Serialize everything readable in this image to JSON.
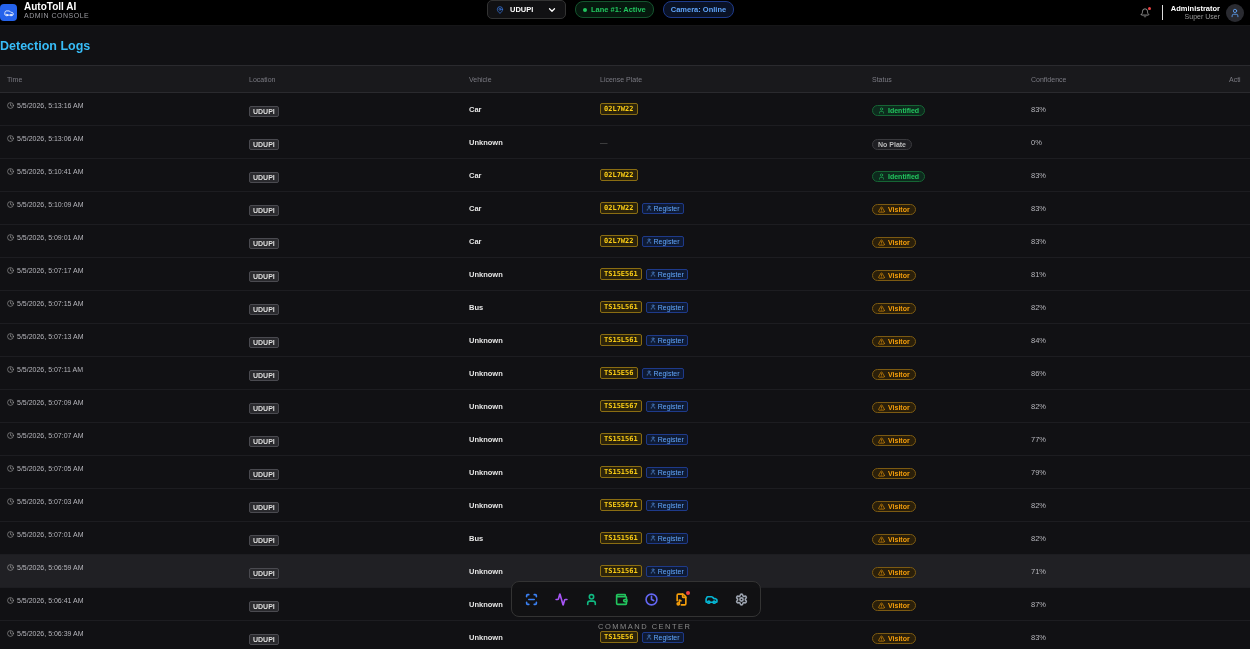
{
  "header": {
    "app_name": "AutoToll AI",
    "app_subtitle": "ADMIN CONSOLE",
    "location": "UDUPI",
    "lane_status": "Lane #1: Active",
    "camera_status": "Camera: Online",
    "notification_badge": true,
    "user_name": "Administrator",
    "user_role": "Super User"
  },
  "page_title": "Detection Logs",
  "table": {
    "columns": [
      "Time",
      "Location",
      "Vehicle",
      "License Plate",
      "Status",
      "Confidence",
      "Acti"
    ],
    "rows": [
      {
        "time": "5/5/2026, 5:13:16 AM",
        "location": "UDUPI",
        "vehicle": "Car",
        "plate": {
          "kind": "plate",
          "text": "02L7W22"
        },
        "status": {
          "kind": "identified",
          "text": "Identified"
        },
        "confidence": "83%",
        "selected": false
      },
      {
        "time": "5/5/2026, 5:13:06 AM",
        "location": "UDUPI",
        "vehicle": "Unknown",
        "plate": {
          "kind": "none",
          "text": "—"
        },
        "status": {
          "kind": "no_plate",
          "text": "No Plate"
        },
        "confidence": "0%",
        "selected": false
      },
      {
        "time": "5/5/2026, 5:10:41 AM",
        "location": "UDUPI",
        "vehicle": "Car",
        "plate": {
          "kind": "plate",
          "text": "02L7W22"
        },
        "status": {
          "kind": "identified",
          "text": "Identified"
        },
        "confidence": "83%",
        "selected": false
      },
      {
        "time": "5/5/2026, 5:10:09 AM",
        "location": "UDUPI",
        "vehicle": "Car",
        "plate": {
          "kind": "plate",
          "text": "02L7W22"
        },
        "register": "Register",
        "status": {
          "kind": "visitor",
          "text": "Visitor"
        },
        "confidence": "83%",
        "selected": false
      },
      {
        "time": "5/5/2026, 5:09:01 AM",
        "location": "UDUPI",
        "vehicle": "Car",
        "plate": {
          "kind": "plate",
          "text": "02L7W22"
        },
        "register": "Register",
        "status": {
          "kind": "visitor",
          "text": "Visitor"
        },
        "confidence": "83%",
        "selected": false
      },
      {
        "time": "5/5/2026, 5:07:17 AM",
        "location": "UDUPI",
        "vehicle": "Unknown",
        "plate": {
          "kind": "plate",
          "text": "TS15E561"
        },
        "register": "Register",
        "status": {
          "kind": "visitor",
          "text": "Visitor"
        },
        "confidence": "81%",
        "selected": false
      },
      {
        "time": "5/5/2026, 5:07:15 AM",
        "location": "UDUPI",
        "vehicle": "Bus",
        "plate": {
          "kind": "plate",
          "text": "TS15L561"
        },
        "register": "Register",
        "status": {
          "kind": "visitor",
          "text": "Visitor"
        },
        "confidence": "82%",
        "selected": false
      },
      {
        "time": "5/5/2026, 5:07:13 AM",
        "location": "UDUPI",
        "vehicle": "Unknown",
        "plate": {
          "kind": "plate",
          "text": "TS15L561"
        },
        "register": "Register",
        "status": {
          "kind": "visitor",
          "text": "Visitor"
        },
        "confidence": "84%",
        "selected": false
      },
      {
        "time": "5/5/2026, 5:07:11 AM",
        "location": "UDUPI",
        "vehicle": "Unknown",
        "plate": {
          "kind": "plate",
          "text": "TS15E56"
        },
        "register": "Register",
        "status": {
          "kind": "visitor",
          "text": "Visitor"
        },
        "confidence": "86%",
        "selected": false
      },
      {
        "time": "5/5/2026, 5:07:09 AM",
        "location": "UDUPI",
        "vehicle": "Unknown",
        "plate": {
          "kind": "plate",
          "text": "TS15E567"
        },
        "register": "Register",
        "status": {
          "kind": "visitor",
          "text": "Visitor"
        },
        "confidence": "82%",
        "selected": false
      },
      {
        "time": "5/5/2026, 5:07:07 AM",
        "location": "UDUPI",
        "vehicle": "Unknown",
        "plate": {
          "kind": "plate",
          "text": "TS151561"
        },
        "register": "Register",
        "status": {
          "kind": "visitor",
          "text": "Visitor"
        },
        "confidence": "77%",
        "selected": false
      },
      {
        "time": "5/5/2026, 5:07:05 AM",
        "location": "UDUPI",
        "vehicle": "Unknown",
        "plate": {
          "kind": "plate",
          "text": "TS151561"
        },
        "register": "Register",
        "status": {
          "kind": "visitor",
          "text": "Visitor"
        },
        "confidence": "79%",
        "selected": false
      },
      {
        "time": "5/5/2026, 5:07:03 AM",
        "location": "UDUPI",
        "vehicle": "Unknown",
        "plate": {
          "kind": "plate",
          "text": "TSE55671"
        },
        "register": "Register",
        "status": {
          "kind": "visitor",
          "text": "Visitor"
        },
        "confidence": "82%",
        "selected": false
      },
      {
        "time": "5/5/2026, 5:07:01 AM",
        "location": "UDUPI",
        "vehicle": "Bus",
        "plate": {
          "kind": "plate",
          "text": "TS151561"
        },
        "register": "Register",
        "status": {
          "kind": "visitor",
          "text": "Visitor"
        },
        "confidence": "82%",
        "selected": false
      },
      {
        "time": "5/5/2026, 5:06:59 AM",
        "location": "UDUPI",
        "vehicle": "Unknown",
        "plate": {
          "kind": "plate",
          "text": "TS151561"
        },
        "register": "Register",
        "status": {
          "kind": "visitor",
          "text": "Visitor"
        },
        "confidence": "71%",
        "selected": true
      },
      {
        "time": "5/5/2026, 5:06:41 AM",
        "location": "UDUPI",
        "vehicle": "Unknown",
        "status": {
          "kind": "visitor",
          "text": "Visitor"
        },
        "confidence": "87%",
        "selected": false
      },
      {
        "time": "5/5/2026, 5:06:39 AM",
        "location": "UDUPI",
        "vehicle": "Unknown",
        "plate": {
          "kind": "plate",
          "text": "TS15E56"
        },
        "register": "Register",
        "status": {
          "kind": "visitor",
          "text": "Visitor"
        },
        "confidence": "83%",
        "selected": false
      }
    ]
  },
  "dock": {
    "items": [
      {
        "kind": "scan",
        "color": "#3b82f6",
        "badge": false
      },
      {
        "kind": "activity",
        "color": "#a855f7",
        "badge": false
      },
      {
        "kind": "user",
        "color": "#10b981",
        "badge": false
      },
      {
        "kind": "wallet",
        "color": "#22c55e",
        "badge": false
      },
      {
        "kind": "clock",
        "color": "#6366f1",
        "badge": false
      },
      {
        "kind": "file",
        "color": "#f59e0b",
        "badge": true
      },
      {
        "kind": "car",
        "color": "#06b6d4",
        "badge": false
      },
      {
        "kind": "settings",
        "color": "#9ca3af",
        "badge": false
      }
    ],
    "caption": "COMMAND CENTER"
  }
}
